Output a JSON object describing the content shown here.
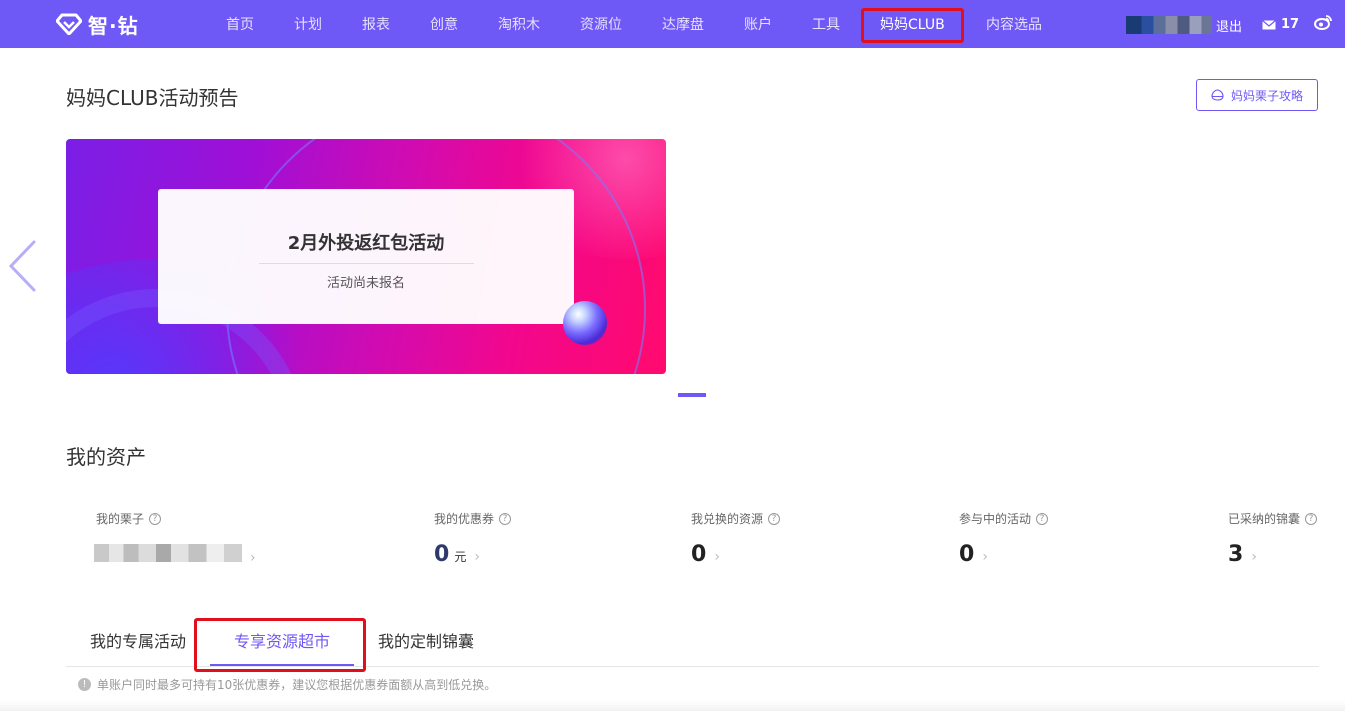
{
  "colors": {
    "brand": "#6f59f6",
    "highlight_box": "#e00f1b"
  },
  "topnav": {
    "logo_text": "智·钻",
    "items": [
      "首页",
      "计划",
      "报表",
      "创意",
      "淘积木",
      "资源位",
      "达摩盘",
      "账户",
      "工具",
      "妈妈CLUB",
      "内容选品"
    ],
    "active": "妈妈CLUB",
    "logout": "退出",
    "message_count": "17"
  },
  "club": {
    "title": "妈妈CLUB活动预告",
    "guide_button": "妈妈栗子攻略",
    "banner": {
      "title": "2月外投返红包活动",
      "status": "活动尚未报名"
    }
  },
  "assets": {
    "title": "我的资产",
    "items": [
      {
        "label": "我的栗子",
        "value": "",
        "unit": ""
      },
      {
        "label": "我的优惠券",
        "value": "0",
        "unit": "元"
      },
      {
        "label": "我兑换的资源",
        "value": "0",
        "unit": ""
      },
      {
        "label": "参与中的活动",
        "value": "0",
        "unit": ""
      },
      {
        "label": "已采纳的锦囊",
        "value": "3",
        "unit": ""
      }
    ]
  },
  "tabs": {
    "items": [
      "我的专属活动",
      "专享资源超市",
      "我的定制锦囊"
    ],
    "active": "专享资源超市"
  },
  "note": "单账户同时最多可持有10张优惠券，建议您根据优惠券面额从高到低兑换。"
}
